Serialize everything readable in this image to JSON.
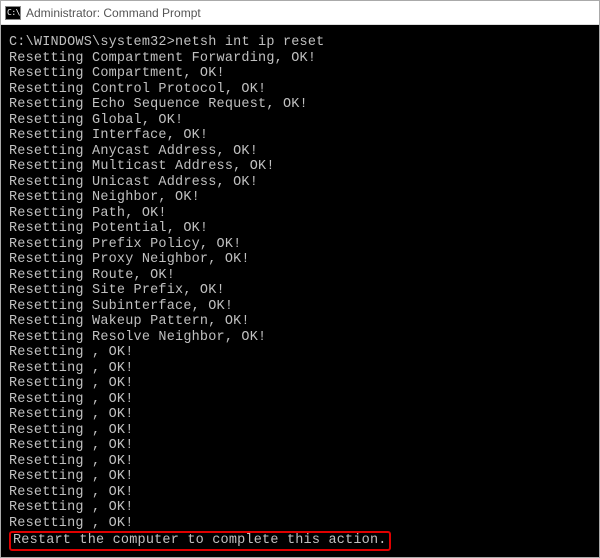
{
  "titlebar": {
    "icon_text": "C:\\.",
    "title": "Administrator: Command Prompt"
  },
  "terminal": {
    "prompt": "C:\\WINDOWS\\system32>",
    "command": "netsh int ip reset",
    "lines": [
      "Resetting Compartment Forwarding, OK!",
      "Resetting Compartment, OK!",
      "Resetting Control Protocol, OK!",
      "Resetting Echo Sequence Request, OK!",
      "Resetting Global, OK!",
      "Resetting Interface, OK!",
      "Resetting Anycast Address, OK!",
      "Resetting Multicast Address, OK!",
      "Resetting Unicast Address, OK!",
      "Resetting Neighbor, OK!",
      "Resetting Path, OK!",
      "Resetting Potential, OK!",
      "Resetting Prefix Policy, OK!",
      "Resetting Proxy Neighbor, OK!",
      "Resetting Route, OK!",
      "Resetting Site Prefix, OK!",
      "Resetting Subinterface, OK!",
      "Resetting Wakeup Pattern, OK!",
      "Resetting Resolve Neighbor, OK!",
      "Resetting , OK!",
      "Resetting , OK!",
      "Resetting , OK!",
      "Resetting , OK!",
      "Resetting , OK!",
      "Resetting , OK!",
      "Resetting , OK!",
      "Resetting , OK!",
      "Resetting , OK!",
      "Resetting , OK!",
      "Resetting , OK!",
      "Resetting , OK!"
    ],
    "final_message": "Restart the computer to complete this action."
  }
}
